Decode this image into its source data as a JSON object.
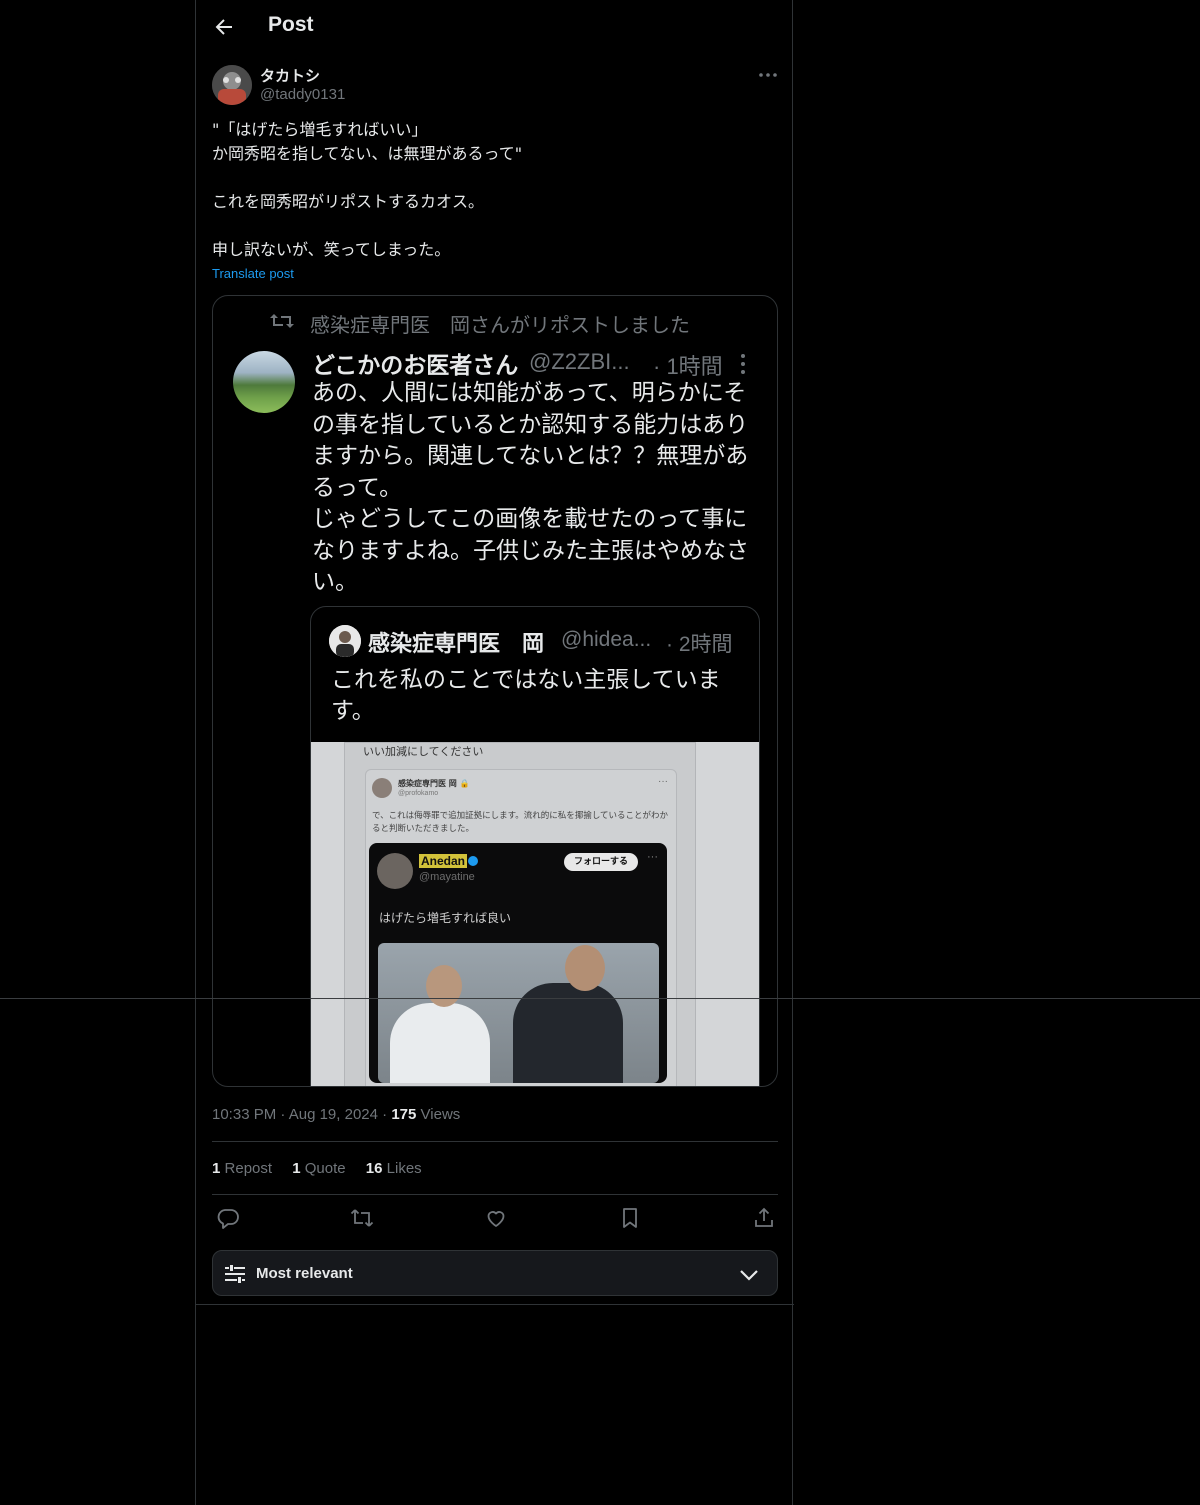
{
  "header": {
    "title": "Post"
  },
  "author": {
    "name": "タカトシ",
    "handle": "@taddy0131"
  },
  "post": {
    "text": "\"「はげたら増毛すればいい」\nか岡秀昭を指してない、は無理があるって\"\n\nこれを岡秀昭がリポストするカオス。\n\n申し訳ないが、笑ってしまった。",
    "translate": "Translate post"
  },
  "media": {
    "repost_text": "感染症専門医　岡さんがリポストしました",
    "name": "どこかのお医者さん",
    "handle": "@Z2ZBI...",
    "time": "· 1時間",
    "text": "あの、人間には知能があって、明らかにその事を指しているとか認知する能力はありますから。関連してないとは？？無理があるって。\nじゃどうしてこの画像を載せたのって事になりますよね。子供じみた主張はやめなさい。",
    "quote": {
      "name": "感染症専門医　岡",
      "handle": "@hidea...",
      "time": "· 2時間",
      "text": "これを私のことではない主張しています。",
      "shot": {
        "top_text": "いい加減にしてください",
        "inner_name": "感染症専門医 岡 🔒",
        "inner_handle": "@profokamo",
        "inner_text": "で、これは侮辱罪で追加証拠にします。流れ的に私を揶揄していることがわかると判断いただきました。",
        "dark_name": "Anedan",
        "dark_handle": "@mayatine",
        "follow": "フォローする",
        "dark_text": "はげたら増毛すれば良い"
      }
    }
  },
  "meta": {
    "time": "10:33 PM",
    "sep": "·",
    "date": "Aug 19, 2024",
    "views_count": "175",
    "views_label": "Views"
  },
  "stats": [
    {
      "count": "1",
      "label": "Repost"
    },
    {
      "count": "1",
      "label": "Quote"
    },
    {
      "count": "16",
      "label": "Likes"
    }
  ],
  "sort": {
    "label": "Most relevant"
  },
  "colors": {
    "accent": "#1d9bf0",
    "muted": "#71767b",
    "border": "#2f3336",
    "background": "#000000"
  }
}
